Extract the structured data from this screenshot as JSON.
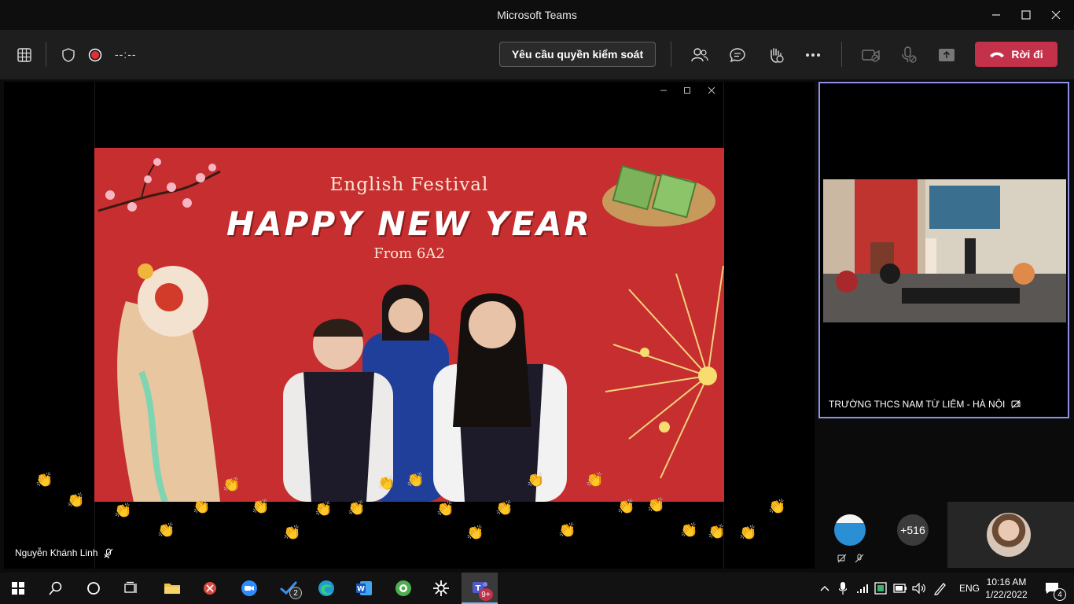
{
  "window": {
    "title": "Microsoft Teams"
  },
  "toolbar": {
    "timer": "--:--",
    "request_control_label": "Yêu cầu quyền kiểm soát",
    "leave_label": "Rời đi"
  },
  "stage": {
    "banner": {
      "festival": "English Festival",
      "headline": "HAPPY NEW YEAR",
      "from": "From 6A2"
    },
    "presenter_name": "Nguyễn Khánh Linh"
  },
  "side_tile": {
    "name": "TRƯỜNG THCS NAM TỪ LIÊM - HÀ NỘI"
  },
  "gallery": {
    "overflow_count": "+516"
  },
  "taskbar": {
    "tasks_badge": "2",
    "teams_badge": "9+",
    "language": "ENG",
    "time": "10:16 AM",
    "date": "1/22/2022",
    "notifications": "4"
  },
  "colors": {
    "leave": "#c4314b",
    "accent_border": "#8f90e8",
    "banner": "#c62e30",
    "titlebar": "#0e0e0e",
    "toolbar": "#1e1e1e"
  }
}
